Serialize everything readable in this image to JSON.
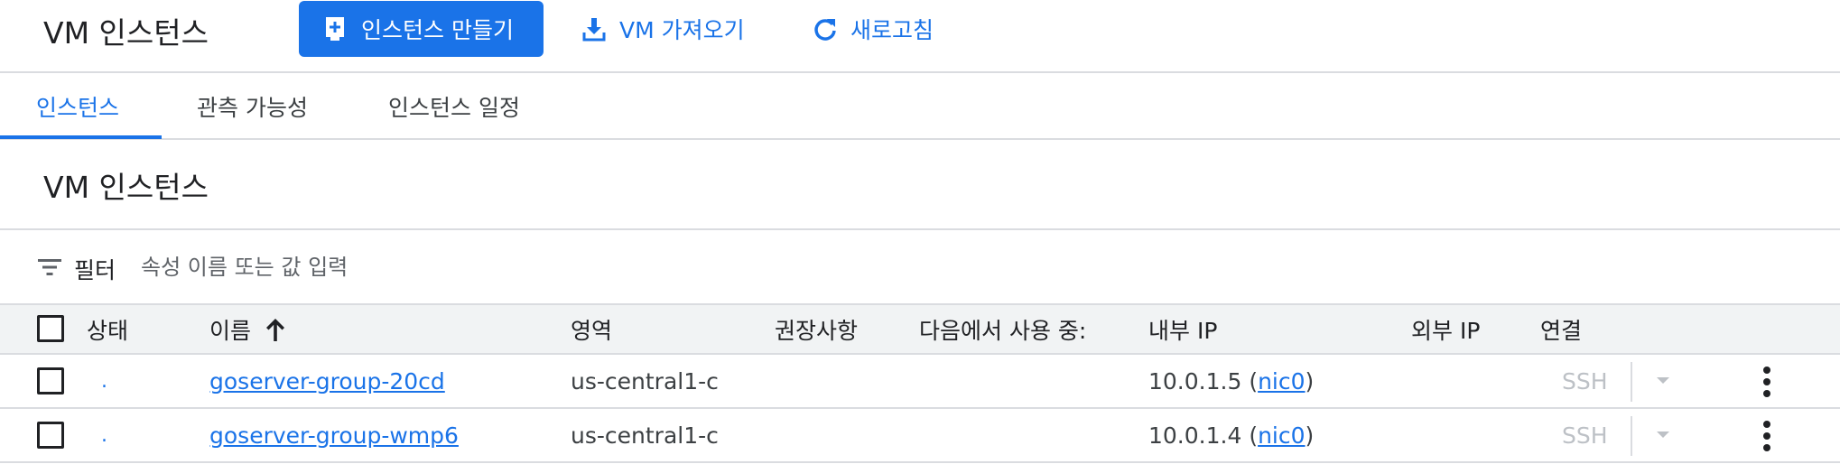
{
  "header": {
    "title": "VM 인스턴스",
    "create_label": "인스턴스 만들기",
    "import_label": "VM 가져오기",
    "refresh_label": "새로고침"
  },
  "tabs": [
    {
      "label": "인스턴스",
      "active": true
    },
    {
      "label": "관측 가능성",
      "active": false
    },
    {
      "label": "인스턴스 일정",
      "active": false
    }
  ],
  "section": {
    "title": "VM 인스턴스"
  },
  "filter": {
    "label": "필터",
    "placeholder": "속성 이름 또는 값 입력",
    "value": ""
  },
  "table": {
    "columns": [
      "상태",
      "이름",
      "영역",
      "권장사항",
      "다음에서 사용 중:",
      "내부 IP",
      "외부 IP",
      "연결"
    ],
    "sort_column": "이름",
    "sort_direction": "ascending",
    "rows": [
      {
        "status": ".",
        "name": "goserver-group-20cd",
        "zone": "us-central1-c",
        "recommendation": "",
        "in_use_by": "",
        "internal_ip": "10.0.1.5",
        "nic": "nic0",
        "external_ip": "",
        "connect": "SSH"
      },
      {
        "status": ".",
        "name": "goserver-group-wmp6",
        "zone": "us-central1-c",
        "recommendation": "",
        "in_use_by": "",
        "internal_ip": "10.0.1.4",
        "nic": "nic0",
        "external_ip": "",
        "connect": "SSH"
      }
    ]
  },
  "colors": {
    "accent": "#1a73e8",
    "border": "#dadce0",
    "header_bg": "#f1f3f4",
    "disabled_text": "#bdc1c6"
  },
  "icons": [
    "add-instance-icon",
    "download-icon",
    "refresh-icon",
    "filter-icon",
    "sort-arrow-up-icon",
    "caret-down-icon",
    "more-vert-icon"
  ]
}
